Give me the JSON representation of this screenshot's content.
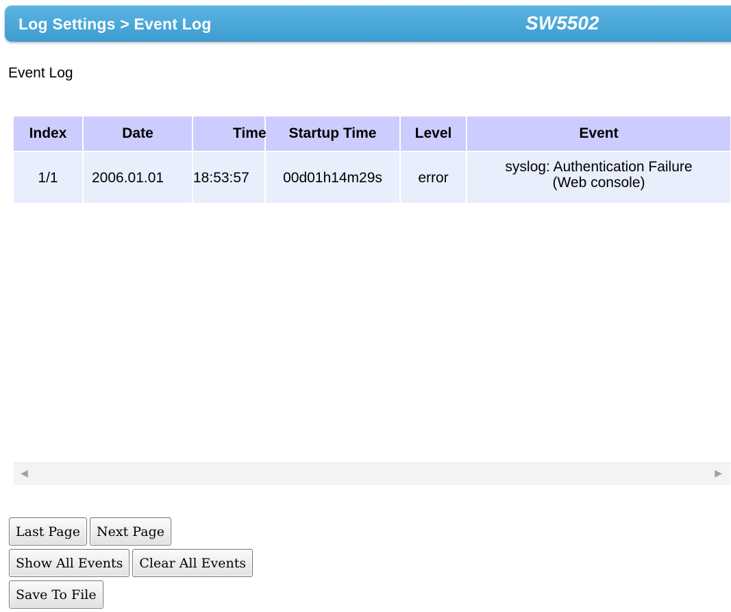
{
  "header": {
    "breadcrumb": "Log Settings > Event Log",
    "model": "SW5502"
  },
  "section_title": "Event Log",
  "table": {
    "columns": [
      "Index",
      "Date",
      "Time",
      "Startup Time",
      "Level",
      "Event"
    ],
    "rows": [
      {
        "index": "1/1",
        "date": "2006.01.01",
        "time": "18:53:57",
        "startup_time": "00d01h14m29s",
        "level": "error",
        "event_line1": "syslog: Authentication Failure",
        "event_line2": "(Web console)"
      }
    ]
  },
  "scrollbar": {
    "left_arrow": "◀",
    "right_arrow": "▶"
  },
  "buttons": {
    "last_page": "Last Page",
    "next_page": "Next Page",
    "show_all_events": "Show All Events",
    "clear_all_events": "Clear All Events",
    "save_to_file": "Save To File"
  },
  "colors": {
    "header_bar": "#4aa7d8",
    "table_header": "#ccccff",
    "table_row": "#e8eefc"
  }
}
